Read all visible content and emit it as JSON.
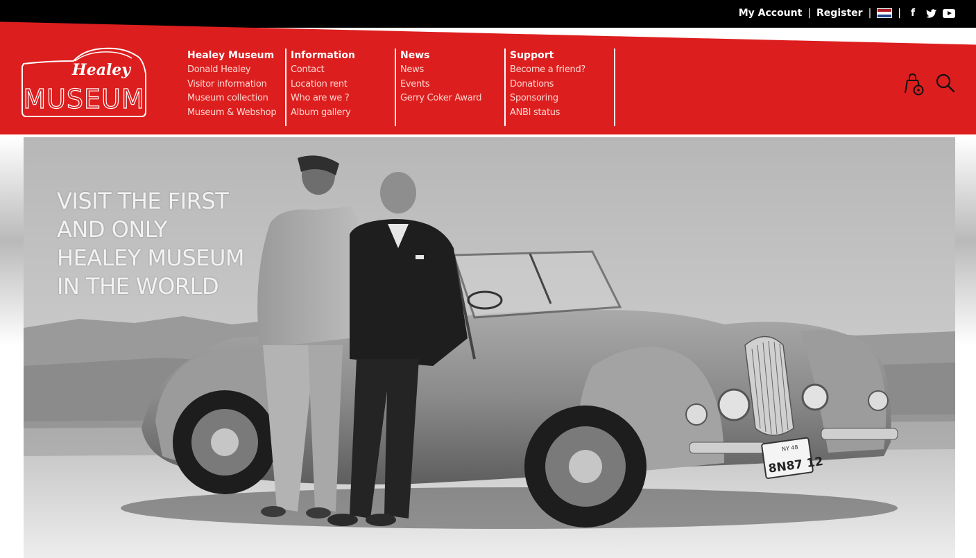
{
  "topbar": {
    "my_account": "My Account",
    "register": "Register",
    "separator": "|",
    "flag_colors": [
      "#ae1c28",
      "#ffffff",
      "#21468b"
    ],
    "icons": [
      "facebook-icon",
      "twitter-icon",
      "youtube-icon"
    ],
    "facebook_glyph": "f"
  },
  "brand": {
    "accent_red": "#dd1e1e",
    "logo_script": "Healey",
    "logo_text": "MUSEUM"
  },
  "nav": [
    {
      "heading": "Healey Museum",
      "items": [
        "Donald Healey",
        "Visitor information",
        "Museum collection",
        "Museum & Webshop"
      ]
    },
    {
      "heading": "Information",
      "items": [
        "Contact",
        "Location rent",
        "Who are we ?",
        "Album gallery"
      ]
    },
    {
      "heading": "News",
      "items": [
        "News",
        "Events",
        "Gerry Coker Award"
      ]
    },
    {
      "heading": "Support",
      "items": [
        "Become a friend?",
        "Donations",
        "Sponsoring",
        "ANBI status"
      ]
    }
  ],
  "header_icons": [
    "shopping-bag-icon",
    "search-icon"
  ],
  "hero": {
    "title_lines": [
      "VISIT THE FIRST",
      "AND ONLY",
      "HEALEY MUSEUM",
      "IN THE WORLD"
    ],
    "plate_text": "8N87 12",
    "plate_top": "NY 48"
  }
}
